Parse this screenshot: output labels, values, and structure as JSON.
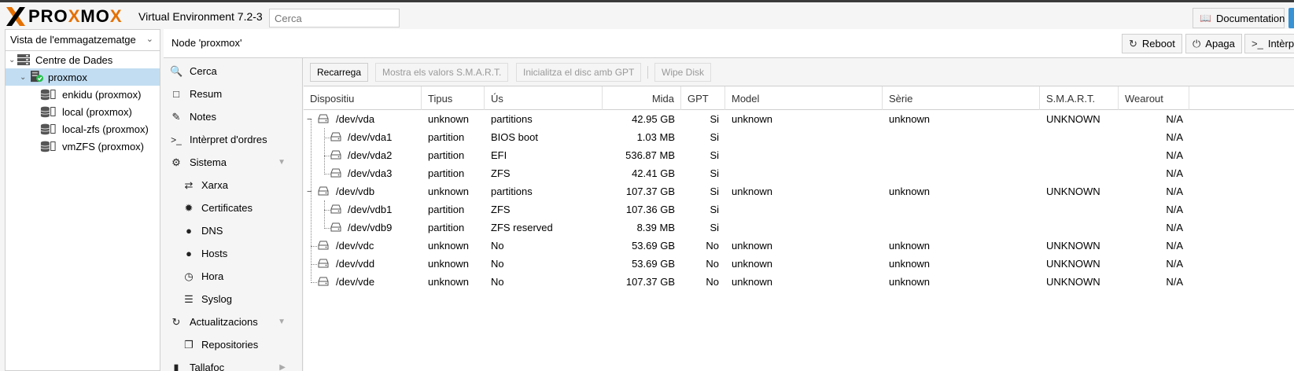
{
  "app": {
    "brand_prefix": "PRO",
    "brand_x": "X",
    "brand_mid": "MO",
    "brand_x2": "X",
    "version": "Virtual Environment 7.2-3",
    "search_placeholder": "Cerca",
    "documentation_label": "Documentation"
  },
  "resource_tree": {
    "view_select": "Vista de l'emmagatzematge",
    "datacenter": "Centre de Dades",
    "node": "proxmox",
    "storages": [
      "enkidu (proxmox)",
      "local (proxmox)",
      "local-zfs (proxmox)",
      "vmZFS (proxmox)"
    ]
  },
  "node_header": {
    "title": "Node 'proxmox'",
    "reboot_label": "Reboot",
    "shutdown_label": "Apaga",
    "shell_label": "Intèrpre"
  },
  "menu": {
    "items": [
      "Cerca",
      "Resum",
      "Notes",
      "Intèrpret d'ordres",
      "Sistema",
      "Xarxa",
      "Certificates",
      "DNS",
      "Hosts",
      "Hora",
      "Syslog",
      "Actualitzacions",
      "Repositories",
      "Tallafoc"
    ]
  },
  "toolbar": {
    "reload_label": "Recarrega",
    "smart_label": "Mostra els valors S.M.A.R.T.",
    "gpt_label": "Inicialitza el disc amb GPT",
    "wipe_label": "Wipe Disk"
  },
  "grid": {
    "columns": [
      "Dispositiu",
      "Tipus",
      "Ús",
      "Mida",
      "GPT",
      "Model",
      "Sèrie",
      "S.M.A.R.T.",
      "Wearout"
    ],
    "rows": [
      {
        "device": "/dev/vda",
        "type": "unknown",
        "usage": "partitions",
        "size": "42.95 GB",
        "gpt": "Si",
        "model": "unknown",
        "serial": "unknown",
        "smart": "UNKNOWN",
        "wearout": "N/A"
      },
      {
        "device": "/dev/vda1",
        "type": "partition",
        "usage": "BIOS boot",
        "size": "1.03 MB",
        "gpt": "Si",
        "model": "",
        "serial": "",
        "smart": "",
        "wearout": "N/A"
      },
      {
        "device": "/dev/vda2",
        "type": "partition",
        "usage": "EFI",
        "size": "536.87 MB",
        "gpt": "Si",
        "model": "",
        "serial": "",
        "smart": "",
        "wearout": "N/A"
      },
      {
        "device": "/dev/vda3",
        "type": "partition",
        "usage": "ZFS",
        "size": "42.41 GB",
        "gpt": "Si",
        "model": "",
        "serial": "",
        "smart": "",
        "wearout": "N/A"
      },
      {
        "device": "/dev/vdb",
        "type": "unknown",
        "usage": "partitions",
        "size": "107.37 GB",
        "gpt": "Si",
        "model": "unknown",
        "serial": "unknown",
        "smart": "UNKNOWN",
        "wearout": "N/A"
      },
      {
        "device": "/dev/vdb1",
        "type": "partition",
        "usage": "ZFS",
        "size": "107.36 GB",
        "gpt": "Si",
        "model": "",
        "serial": "",
        "smart": "",
        "wearout": "N/A"
      },
      {
        "device": "/dev/vdb9",
        "type": "partition",
        "usage": "ZFS reserved",
        "size": "8.39 MB",
        "gpt": "Si",
        "model": "",
        "serial": "",
        "smart": "",
        "wearout": "N/A"
      },
      {
        "device": "/dev/vdc",
        "type": "unknown",
        "usage": "No",
        "size": "53.69 GB",
        "gpt": "No",
        "model": "unknown",
        "serial": "unknown",
        "smart": "UNKNOWN",
        "wearout": "N/A"
      },
      {
        "device": "/dev/vdd",
        "type": "unknown",
        "usage": "No",
        "size": "53.69 GB",
        "gpt": "No",
        "model": "unknown",
        "serial": "unknown",
        "smart": "UNKNOWN",
        "wearout": "N/A"
      },
      {
        "device": "/dev/vde",
        "type": "unknown",
        "usage": "No",
        "size": "107.37 GB",
        "gpt": "No",
        "model": "unknown",
        "serial": "unknown",
        "smart": "UNKNOWN",
        "wearout": "N/A"
      }
    ]
  },
  "colors": {
    "accent_orange": "#e57000",
    "selection": "#c2ddf2",
    "status_green": "#21bf4b",
    "doc_blue": "#3892d4"
  }
}
